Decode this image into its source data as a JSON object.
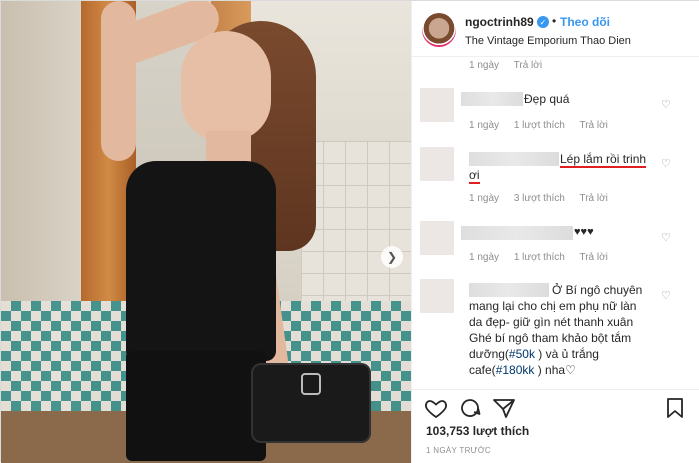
{
  "post": {
    "username": "ngoctrinh89",
    "follow_label": "Theo dõi",
    "separator": "•",
    "location": "The Vintage Emporium Thao Dien",
    "verified_glyph": "✓"
  },
  "carousel": {
    "next_glyph": "❯"
  },
  "comments": [
    {
      "time": "1 ngày",
      "likes": "",
      "reply": "Trả lời"
    },
    {
      "text": "Đẹp quá",
      "time": "1 ngày",
      "likes": "1 lượt thích",
      "reply": "Trả lời"
    },
    {
      "text": "Lép lắm rồi trinh",
      "text2": "ơi",
      "time": "1 ngày",
      "likes": "3 lượt thích",
      "reply": "Trả lời"
    },
    {
      "text": "♥♥♥",
      "time": "1 ngày",
      "likes": "1 lượt thích",
      "reply": "Trả lời"
    },
    {
      "line1": "Ở Bí ngô chuyên",
      "line2": "mang lại cho chị em phụ nữ làn",
      "line3": "da đẹp- giữ gìn nét thanh xuân",
      "line4": "Ghé bí ngô tham khảo bột tắm",
      "line5_pre": "dưỡng(",
      "hashtag1": "#50k",
      "line5_post": " ) và ủ trắng",
      "line6_pre": "cafe(",
      "hashtag2": "#180kk",
      "line6_post": " ) nha♡"
    }
  ],
  "actions": {
    "likes_count": "103,753 lượt thích",
    "time": "1 NGÀY TRƯỚC"
  },
  "icons": [
    "verified-icon",
    "heart-icon",
    "comment-icon",
    "share-icon",
    "bookmark-icon",
    "carousel-next-icon"
  ],
  "colors": {
    "link": "#3897f0",
    "hashtag": "#00376b",
    "underline": "#e02020"
  }
}
